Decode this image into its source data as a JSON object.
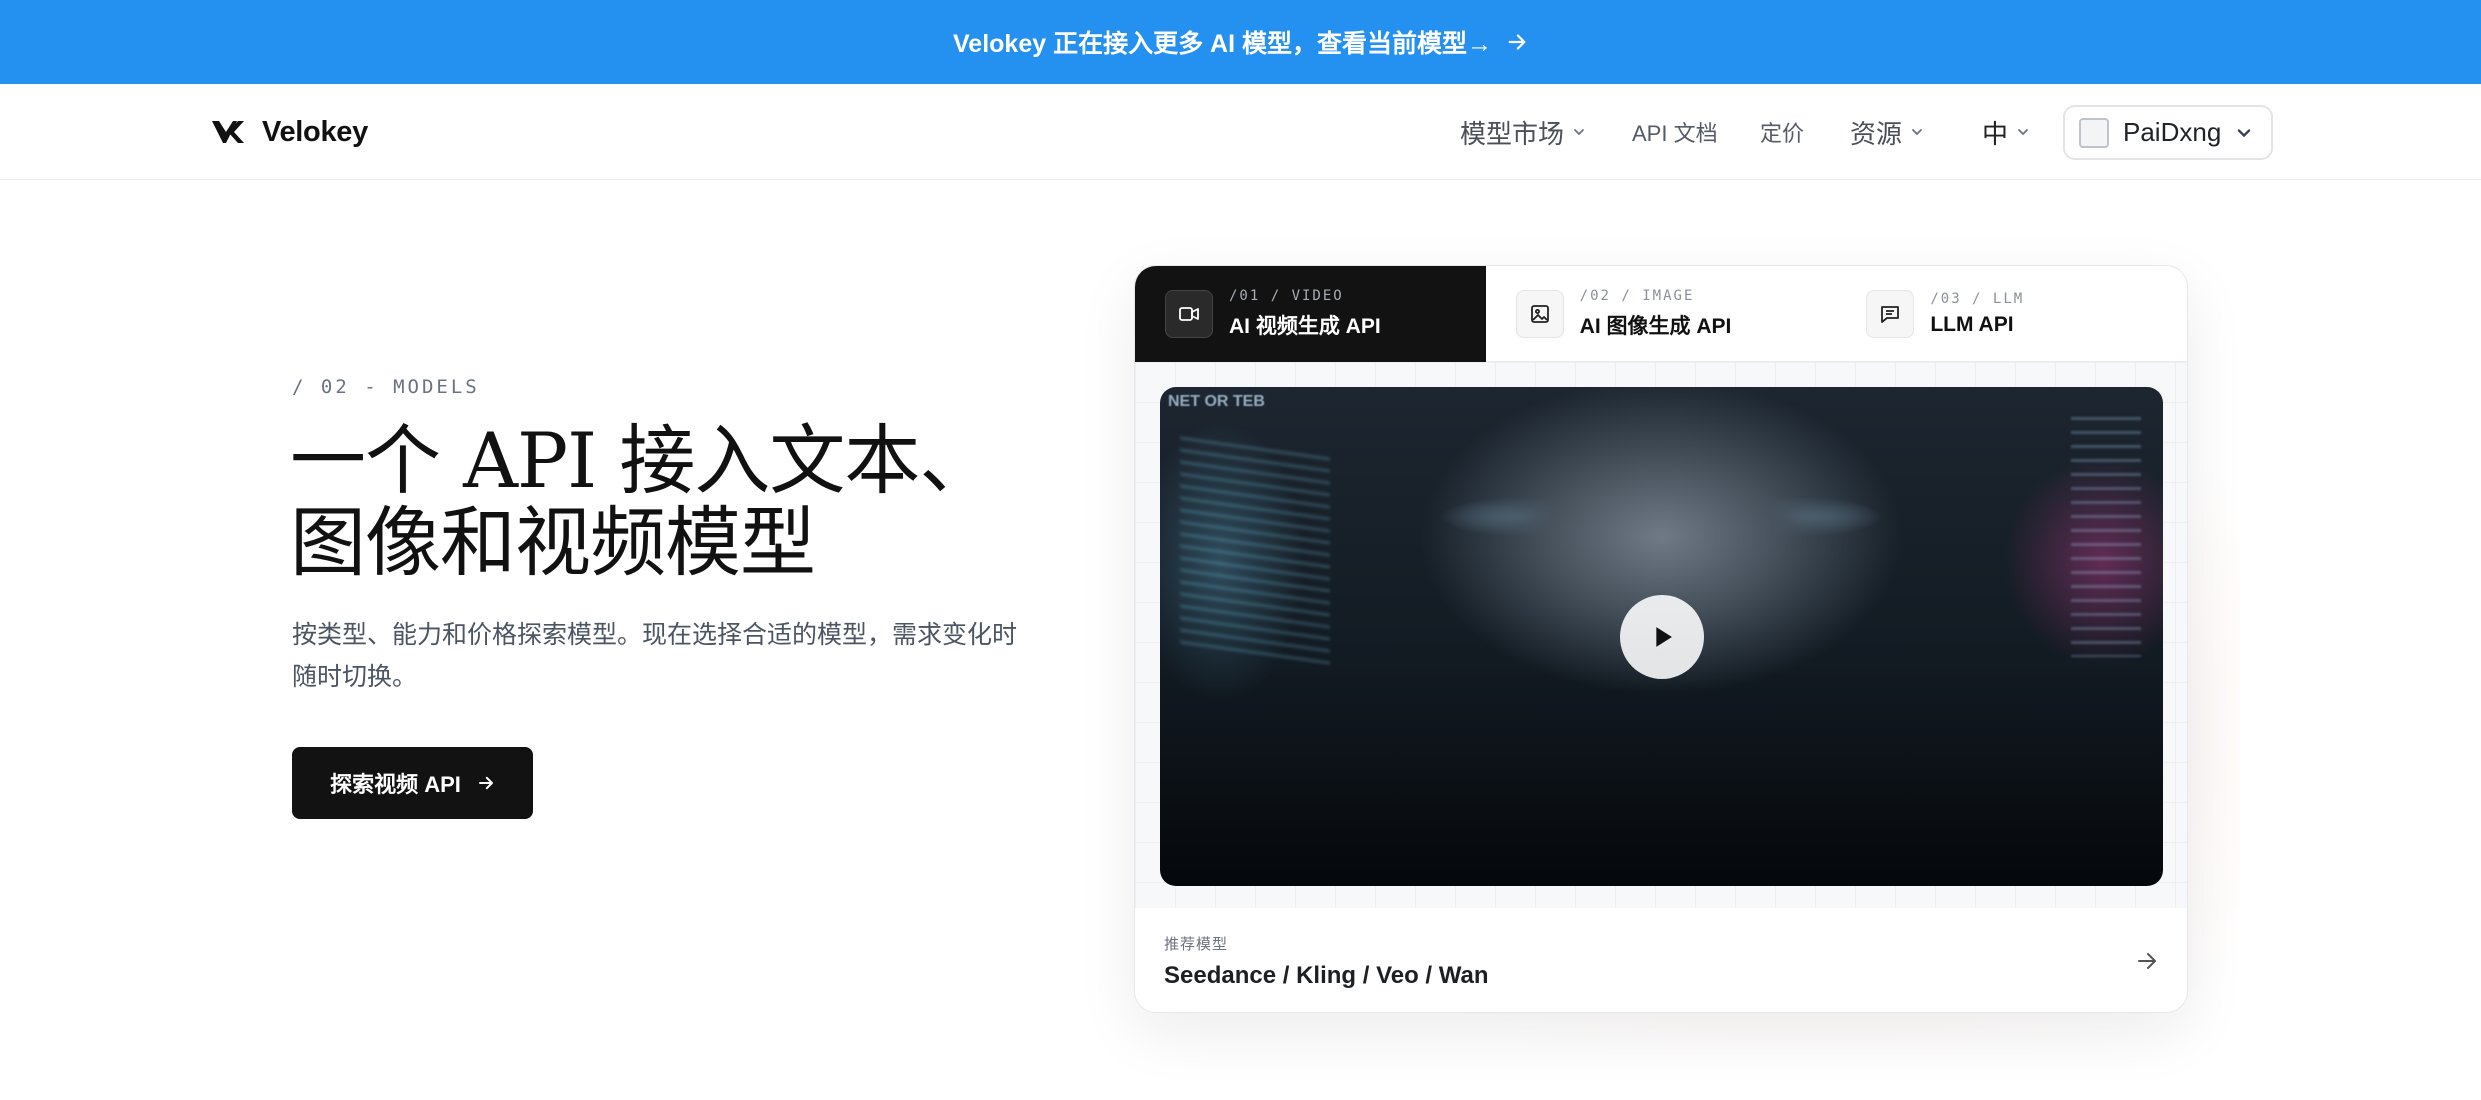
{
  "announcement": {
    "text": "Velokey 正在接入更多 AI 模型，查看当前模型→",
    "icon": "arrow-right-icon"
  },
  "nav": {
    "brand": "Velokey",
    "links": {
      "models": "模型市场",
      "docs": "API 文档",
      "pricing": "定价",
      "resources": "资源",
      "language": "中"
    },
    "user": {
      "name": "PaiDxng"
    }
  },
  "hero": {
    "eyebrow": "/ 02 - MODELS",
    "title_line1": "一个 API 接入文本、",
    "title_line2": "图像和视频模型",
    "subtitle": "按类型、能力和价格探索模型。现在选择合适的模型，需求变化时随时切换。",
    "cta_label": "探索视频 API"
  },
  "showcase": {
    "tabs": [
      {
        "kicker": "/01 / VIDEO",
        "label": "AI 视频生成 API",
        "icon": "video-camera-icon",
        "active": true
      },
      {
        "kicker": "/02 / IMAGE",
        "label": "AI 图像生成 API",
        "icon": "image-icon",
        "active": false
      },
      {
        "kicker": "/03 / LLM",
        "label": "LLM API",
        "icon": "chat-bubble-icon",
        "active": false
      }
    ],
    "video_overlay_text": "NET OR TEB",
    "footer": {
      "kicker": "推荐模型",
      "models": "Seedance / Kling / Veo / Wan"
    }
  },
  "colors": {
    "announcement_bg": "#2490f0",
    "cta_bg": "#121212",
    "active_tab_bg": "#121212"
  }
}
